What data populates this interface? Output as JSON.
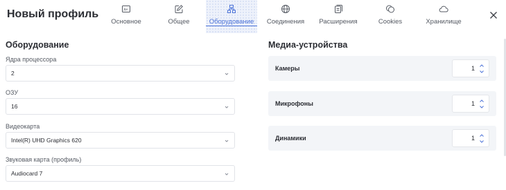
{
  "window": {
    "title": "Новый профиль"
  },
  "tabs": [
    {
      "label": "Основное",
      "icon": "id-card-icon"
    },
    {
      "label": "Общее",
      "icon": "edit-icon"
    },
    {
      "label": "Оборудование",
      "icon": "hardware-icon",
      "active": true
    },
    {
      "label": "Соединения",
      "icon": "globe-icon"
    },
    {
      "label": "Расширения",
      "icon": "extensions-icon"
    },
    {
      "label": "Cookies",
      "icon": "cookies-icon"
    },
    {
      "label": "Хранилище",
      "icon": "cloud-icon"
    }
  ],
  "hardware": {
    "title": "Оборудование",
    "cpu": {
      "label": "Ядра процессора",
      "value": "2"
    },
    "ram": {
      "label": "ОЗУ",
      "value": "16"
    },
    "gpu": {
      "label": "Видеокарта",
      "value": "Intel(R) UHD Graphics 620"
    },
    "audio": {
      "label": "Звуковая карта (профиль)",
      "value": "Audiocard 7"
    }
  },
  "media": {
    "title": "Медиа-устройства",
    "cameras": {
      "label": "Камеры",
      "value": "1"
    },
    "microphones": {
      "label": "Микрофоны",
      "value": "1"
    },
    "speakers": {
      "label": "Динамики",
      "value": "1"
    }
  },
  "colors": {
    "accent": "#4b72d8",
    "text": "#2b2d33",
    "muted": "#555a63",
    "row_bg": "#f3f5f8"
  }
}
